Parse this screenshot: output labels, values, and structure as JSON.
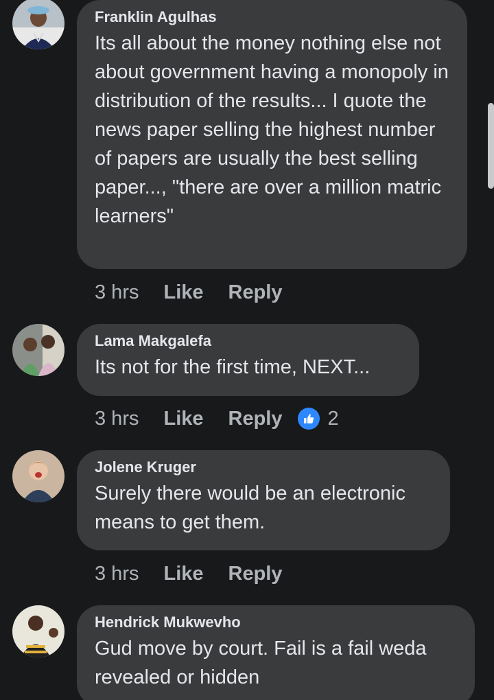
{
  "comments": [
    {
      "author": "Franklin Agulhas",
      "text": "Its all about the money nothing else not about government having a monopoly in distribution of the results... I quote the news paper selling the highest number of papers are usually the best selling paper..., \"there are over a million matric learners\"",
      "time": "3 hrs",
      "like_label": "Like",
      "reply_label": "Reply"
    },
    {
      "author": "Lama Makgalefa",
      "text": "Its not for the first time, NEXT...",
      "time": "3 hrs",
      "like_label": "Like",
      "reply_label": "Reply",
      "reaction_icon": "thumbs-up-icon",
      "reaction_count": "2"
    },
    {
      "author": "Jolene Kruger",
      "text": "Surely there would be an electronic means to get them.",
      "time": "3 hrs",
      "like_label": "Like",
      "reply_label": "Reply"
    },
    {
      "author": "Hendrick Mukwevho",
      "text": "Gud move by court. Fail is a fail weda revealed or hidden"
    }
  ],
  "colors": {
    "background": "#18191a",
    "bubble": "#3a3b3c",
    "text": "#e4e6eb",
    "secondary_text": "#b0b3b8",
    "reaction_blue": "#2d88ff"
  }
}
